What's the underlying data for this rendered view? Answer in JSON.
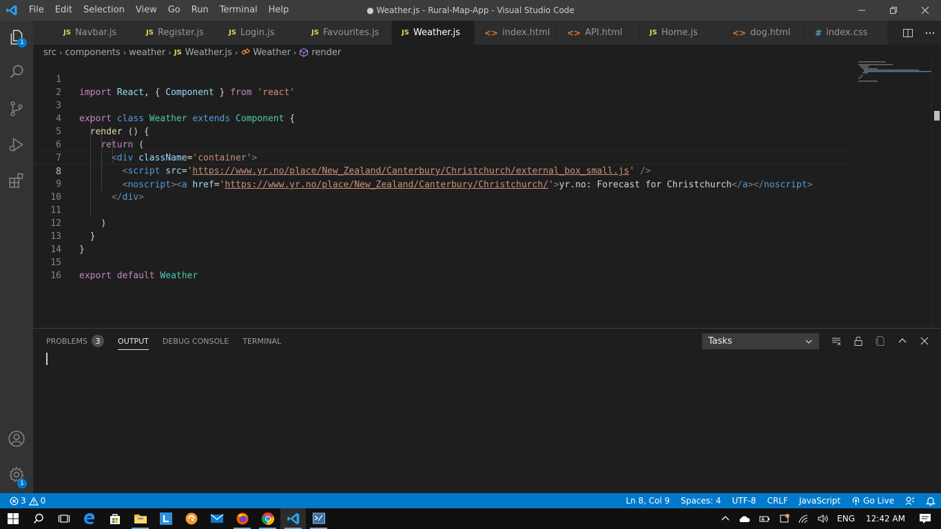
{
  "window": {
    "title": "● Weather.js - Rural-Map-App - Visual Studio Code",
    "menu": [
      "File",
      "Edit",
      "Selection",
      "View",
      "Go",
      "Run",
      "Terminal",
      "Help"
    ]
  },
  "activity": {
    "explorer_badge": "1",
    "settings_badge": "1"
  },
  "tabs": [
    {
      "label": "Navbar.js",
      "icon": "JS"
    },
    {
      "label": "Register.js",
      "icon": "JS"
    },
    {
      "label": "Login.js",
      "icon": "JS"
    },
    {
      "label": "Favourites.js",
      "icon": "JS"
    },
    {
      "label": "Weather.js",
      "icon": "JS"
    },
    {
      "label": "index.html",
      "icon": "<>"
    },
    {
      "label": "API.html",
      "icon": "<>"
    },
    {
      "label": "Home.js",
      "icon": "JS"
    },
    {
      "label": "dog.html",
      "icon": "<>"
    },
    {
      "label": "index.css",
      "icon": "#"
    }
  ],
  "breadcrumb": {
    "src": "src",
    "components": "components",
    "weather": "weather",
    "file_icon": "JS",
    "file": "Weather.js",
    "class": "Weather",
    "method": "render"
  },
  "code": {
    "line_numbers": [
      "1",
      "2",
      "3",
      "4",
      "5",
      "6",
      "7",
      "8",
      "9",
      "10",
      "11",
      "12",
      "13",
      "14",
      "15",
      "16"
    ],
    "l1": {
      "import": "import",
      "react_id": "React",
      "comp_open": ", { ",
      "component": "Component",
      "comp_close": " } ",
      "from": "from",
      "mod": "'react'"
    },
    "l3": {
      "export": "export",
      "class_kw": "class",
      "name": "Weather",
      "extends": "extends",
      "base": "Component",
      "brace": "{"
    },
    "l4": {
      "render": "render",
      "rest": "() {"
    },
    "l5": {
      "return": "return",
      "paren": "("
    },
    "l6": {
      "open": "<",
      "tag": "div",
      "attr": "className",
      "eq": "=",
      "val": "'container'",
      "close": ">"
    },
    "l7": {
      "open": "<",
      "tag": "script",
      "attr": "src",
      "eq": "=",
      "q1": "'",
      "url": "https://www.yr.no/place/New_Zealand/Canterbury/Christchurch/external_box_small.js",
      "q2": "'",
      "close": " />"
    },
    "l8": {
      "open": "<",
      "tag": "noscript",
      "close": ">",
      "a_open": "<",
      "a_tag": "a",
      "attr": "href",
      "eq": "=",
      "q1": "'",
      "url": "https://www.yr.no/place/New_Zealand/Canterbury/Christchurch/",
      "q2": "'",
      "a_close": ">",
      "text": "yr.no: Forecast for Christchurch",
      "end_a_open": "</",
      "end_a": "a",
      "end_a_close": ">",
      "end_ns_open": "</",
      "end_ns": "noscript",
      "end_ns_close": ">"
    },
    "l9": {
      "open": "</",
      "tag": "div",
      "close": ">"
    },
    "l11": {
      "paren": ")"
    },
    "l12": {
      "brace": "}"
    },
    "l13": {
      "brace": "}"
    },
    "l15": {
      "export": "export",
      "default": "default",
      "name": "Weather"
    }
  },
  "panel": {
    "tabs": {
      "problems": "PROBLEMS",
      "problems_count": "3",
      "output": "OUTPUT",
      "debug": "DEBUG CONSOLE",
      "terminal": "TERMINAL"
    },
    "select_value": "Tasks"
  },
  "status": {
    "errors": "3",
    "warnings": "0",
    "position": "Ln 8, Col 9",
    "spaces": "Spaces: 4",
    "encoding": "UTF-8",
    "eol": "CRLF",
    "language": "JavaScript",
    "golive": "Go Live"
  },
  "taskbar": {
    "lang": "ENG",
    "time": "12:42 AM"
  },
  "colors": {
    "accent": "#007acc",
    "titlebar": "#3c3c3c",
    "activitybar": "#333333",
    "editor_bg": "#1e1e1e"
  }
}
